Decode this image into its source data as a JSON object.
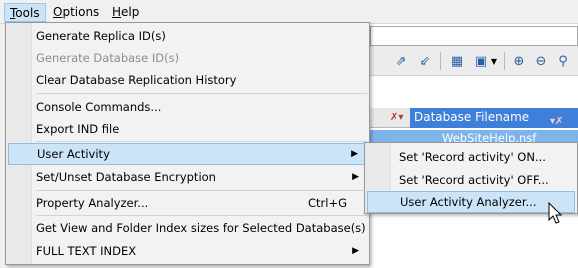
{
  "menubar": {
    "items": [
      {
        "label": "Tools",
        "underline": "T",
        "rest": "ools"
      },
      {
        "label": "Options",
        "underline": "O",
        "rest": "ptions"
      },
      {
        "label": "Help",
        "underline": "H",
        "rest": "elp"
      }
    ]
  },
  "background": {
    "column_header": "Database Filename",
    "row_value": "WebSiteHelp.nsf"
  },
  "tools_menu": {
    "items": [
      {
        "label": "Generate Replica ID(s)"
      },
      {
        "label": "Generate Database ID(s)",
        "disabled": true
      },
      {
        "label": "Clear Database Replication History"
      },
      {
        "label": "Console Commands..."
      },
      {
        "label": "Export IND file"
      },
      {
        "label": "User Activity",
        "submenu": true,
        "highlighted": true
      },
      {
        "label": "Set/Unset Database Encryption",
        "submenu": true
      },
      {
        "label": "Property Analyzer...",
        "shortcut": "Ctrl+G"
      },
      {
        "label": "Get View and Folder Index sizes for Selected Database(s)"
      },
      {
        "label": "FULL TEXT INDEX",
        "submenu": true
      }
    ]
  },
  "user_activity_submenu": {
    "items": [
      {
        "label": "Set 'Record activity' ON..."
      },
      {
        "label": "Set 'Record activity' OFF..."
      },
      {
        "label": "User Activity Analyzer...",
        "highlighted": true
      }
    ]
  },
  "icons": {
    "submenu_arrow": "chevron-right-icon",
    "filter": "filter-icon",
    "cursor": "mouse-pointer-icon"
  },
  "colors": {
    "menu_highlight": "#cce4f7",
    "column_header_bg": "#3d7fd9",
    "selected_row_bg": "#7eb4ea"
  }
}
